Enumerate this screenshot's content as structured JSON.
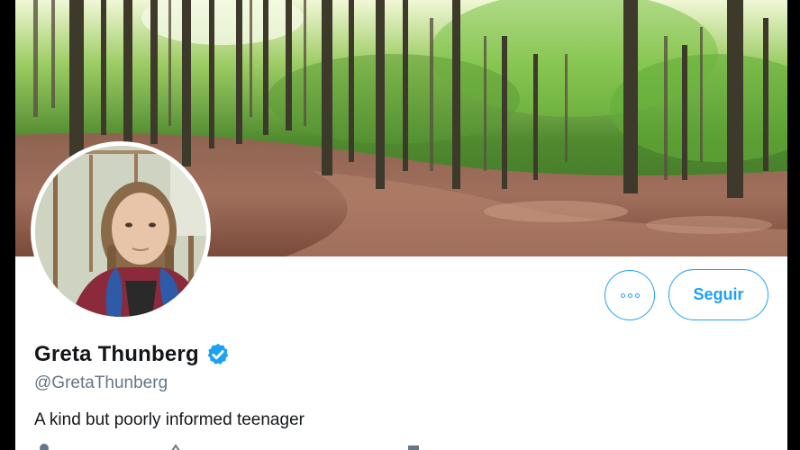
{
  "profile": {
    "display_name": "Greta Thunberg",
    "handle": "@GretaThunberg",
    "bio": "A kind but poorly informed teenager",
    "verified": true
  },
  "actions": {
    "follow_label": "Seguir"
  },
  "icons": {
    "more": "more-options-icon",
    "verified": "verified-badge-icon",
    "location": "location-icon",
    "link": "link-icon",
    "calendar": "calendar-icon"
  },
  "colors": {
    "accent": "#1da1f2",
    "text": "#14171a",
    "secondary_text": "#657786"
  }
}
